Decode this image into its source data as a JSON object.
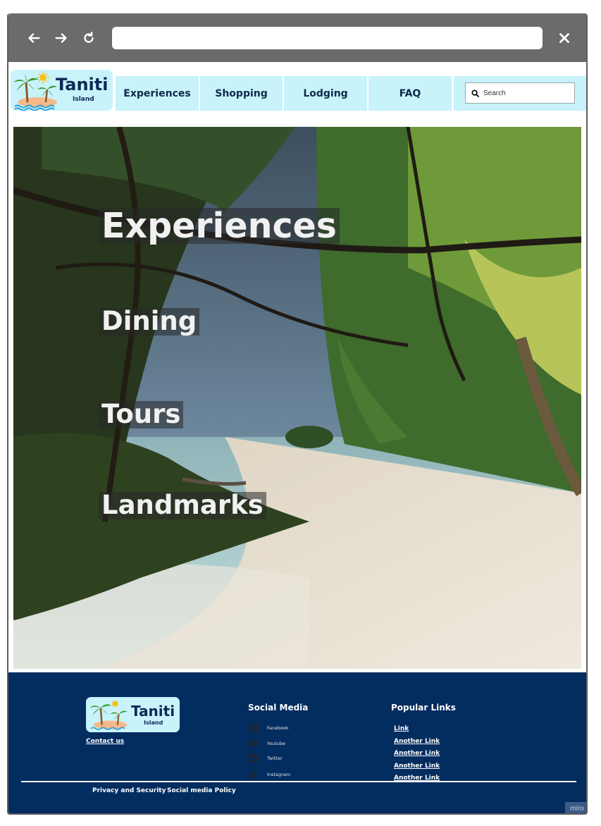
{
  "browser": {
    "back_icon": "arrow-left-icon",
    "forward_icon": "arrow-right-icon",
    "reload_icon": "reload-icon",
    "close_icon": "close-icon",
    "url": ""
  },
  "logo": {
    "name": "Taniti",
    "sub": "Island"
  },
  "nav": {
    "items": [
      {
        "label": "Experiences"
      },
      {
        "label": "Shopping"
      },
      {
        "label": "Lodging"
      },
      {
        "label": "FAQ"
      }
    ],
    "search_placeholder": "Search",
    "search_icon": "search-icon"
  },
  "hero": {
    "links": [
      "Experiences",
      "Dining",
      "Tours",
      "Landmarks"
    ]
  },
  "footer": {
    "contact": "Contact us",
    "social_heading": "Social Media",
    "social": [
      {
        "label": "Facebook",
        "icon": "facebook-icon"
      },
      {
        "label": "Youtube",
        "icon": "youtube-icon"
      },
      {
        "label": "Twitter",
        "icon": "twitter-icon"
      },
      {
        "label": "Instagram",
        "icon": "instagram-icon"
      }
    ],
    "popular_heading": "Popular Links",
    "popular": [
      "Link",
      "Another Link",
      "Another Link",
      "Another Link",
      "Another Link"
    ],
    "legal": [
      "Privacy and Security",
      "Social media Policy"
    ],
    "watermark": "miro"
  },
  "colors": {
    "chrome": "#6b6b6b",
    "nav_bg": "#c8f3fb",
    "footer_bg": "#032c5f",
    "logo_text": "#0d2a55"
  }
}
